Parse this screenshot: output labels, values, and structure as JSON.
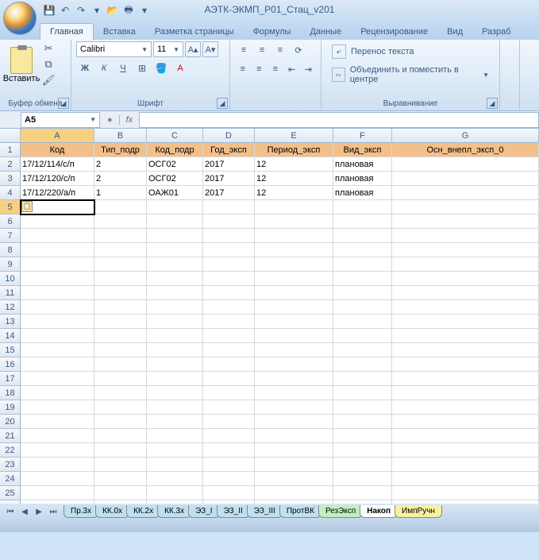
{
  "window": {
    "title": "АЭТК-ЭКМП_Р01_Стац_v201"
  },
  "tabs": {
    "home": "Главная",
    "insert": "Вставка",
    "layout": "Разметка страницы",
    "formulas": "Формулы",
    "data": "Данные",
    "review": "Рецензирование",
    "view": "Вид",
    "dev": "Разраб"
  },
  "ribbon": {
    "paste": "Вставить",
    "clipboard": "Буфер обмена",
    "font_name": "Calibri",
    "font_size": "11",
    "font_group": "Шрифт",
    "wrap": "Перенос текста",
    "merge": "Объединить и поместить в центре",
    "align_group": "Выравнивание"
  },
  "formula": {
    "cell_ref": "A5",
    "fx": "fx"
  },
  "columns": [
    "A",
    "B",
    "C",
    "D",
    "E",
    "F",
    "G"
  ],
  "headers": {
    "A": "Код",
    "B": "Тип_подр",
    "C": "Код_подр",
    "D": "Год_эксп",
    "E": "Период_эксп",
    "F": "Вид_эксп",
    "G": "Осн_внепл_эксп_0"
  },
  "data_rows": [
    {
      "A": "17/12/114/с/п",
      "B": "2",
      "C": "ОСГ02",
      "D": "2017",
      "E": "12",
      "F": "плановая",
      "G": ""
    },
    {
      "A": "17/12/120/с/п",
      "B": "2",
      "C": "ОСГ02",
      "D": "2017",
      "E": "12",
      "F": "плановая",
      "G": ""
    },
    {
      "A": "17/12/220/а/п",
      "B": "1",
      "C": "ОАЖ01",
      "D": "2017",
      "E": "12",
      "F": "плановая",
      "G": ""
    }
  ],
  "active_cell": "A5",
  "sheet_tabs": [
    {
      "name": "Пр.3х",
      "cls": "st-blue"
    },
    {
      "name": "КК.0х",
      "cls": "st-blue"
    },
    {
      "name": "КК.2х",
      "cls": "st-blue"
    },
    {
      "name": "КК.3х",
      "cls": "st-blue"
    },
    {
      "name": "ЭЗ_I",
      "cls": "st-blue"
    },
    {
      "name": "ЭЗ_II",
      "cls": "st-blue"
    },
    {
      "name": "ЭЗ_III",
      "cls": "st-blue"
    },
    {
      "name": "ПротВК",
      "cls": "st-blue"
    },
    {
      "name": "РезЭксп",
      "cls": "st-green"
    },
    {
      "name": "Накоп",
      "cls": "st-active"
    },
    {
      "name": "ИмпРучн",
      "cls": "st-yellow"
    }
  ]
}
